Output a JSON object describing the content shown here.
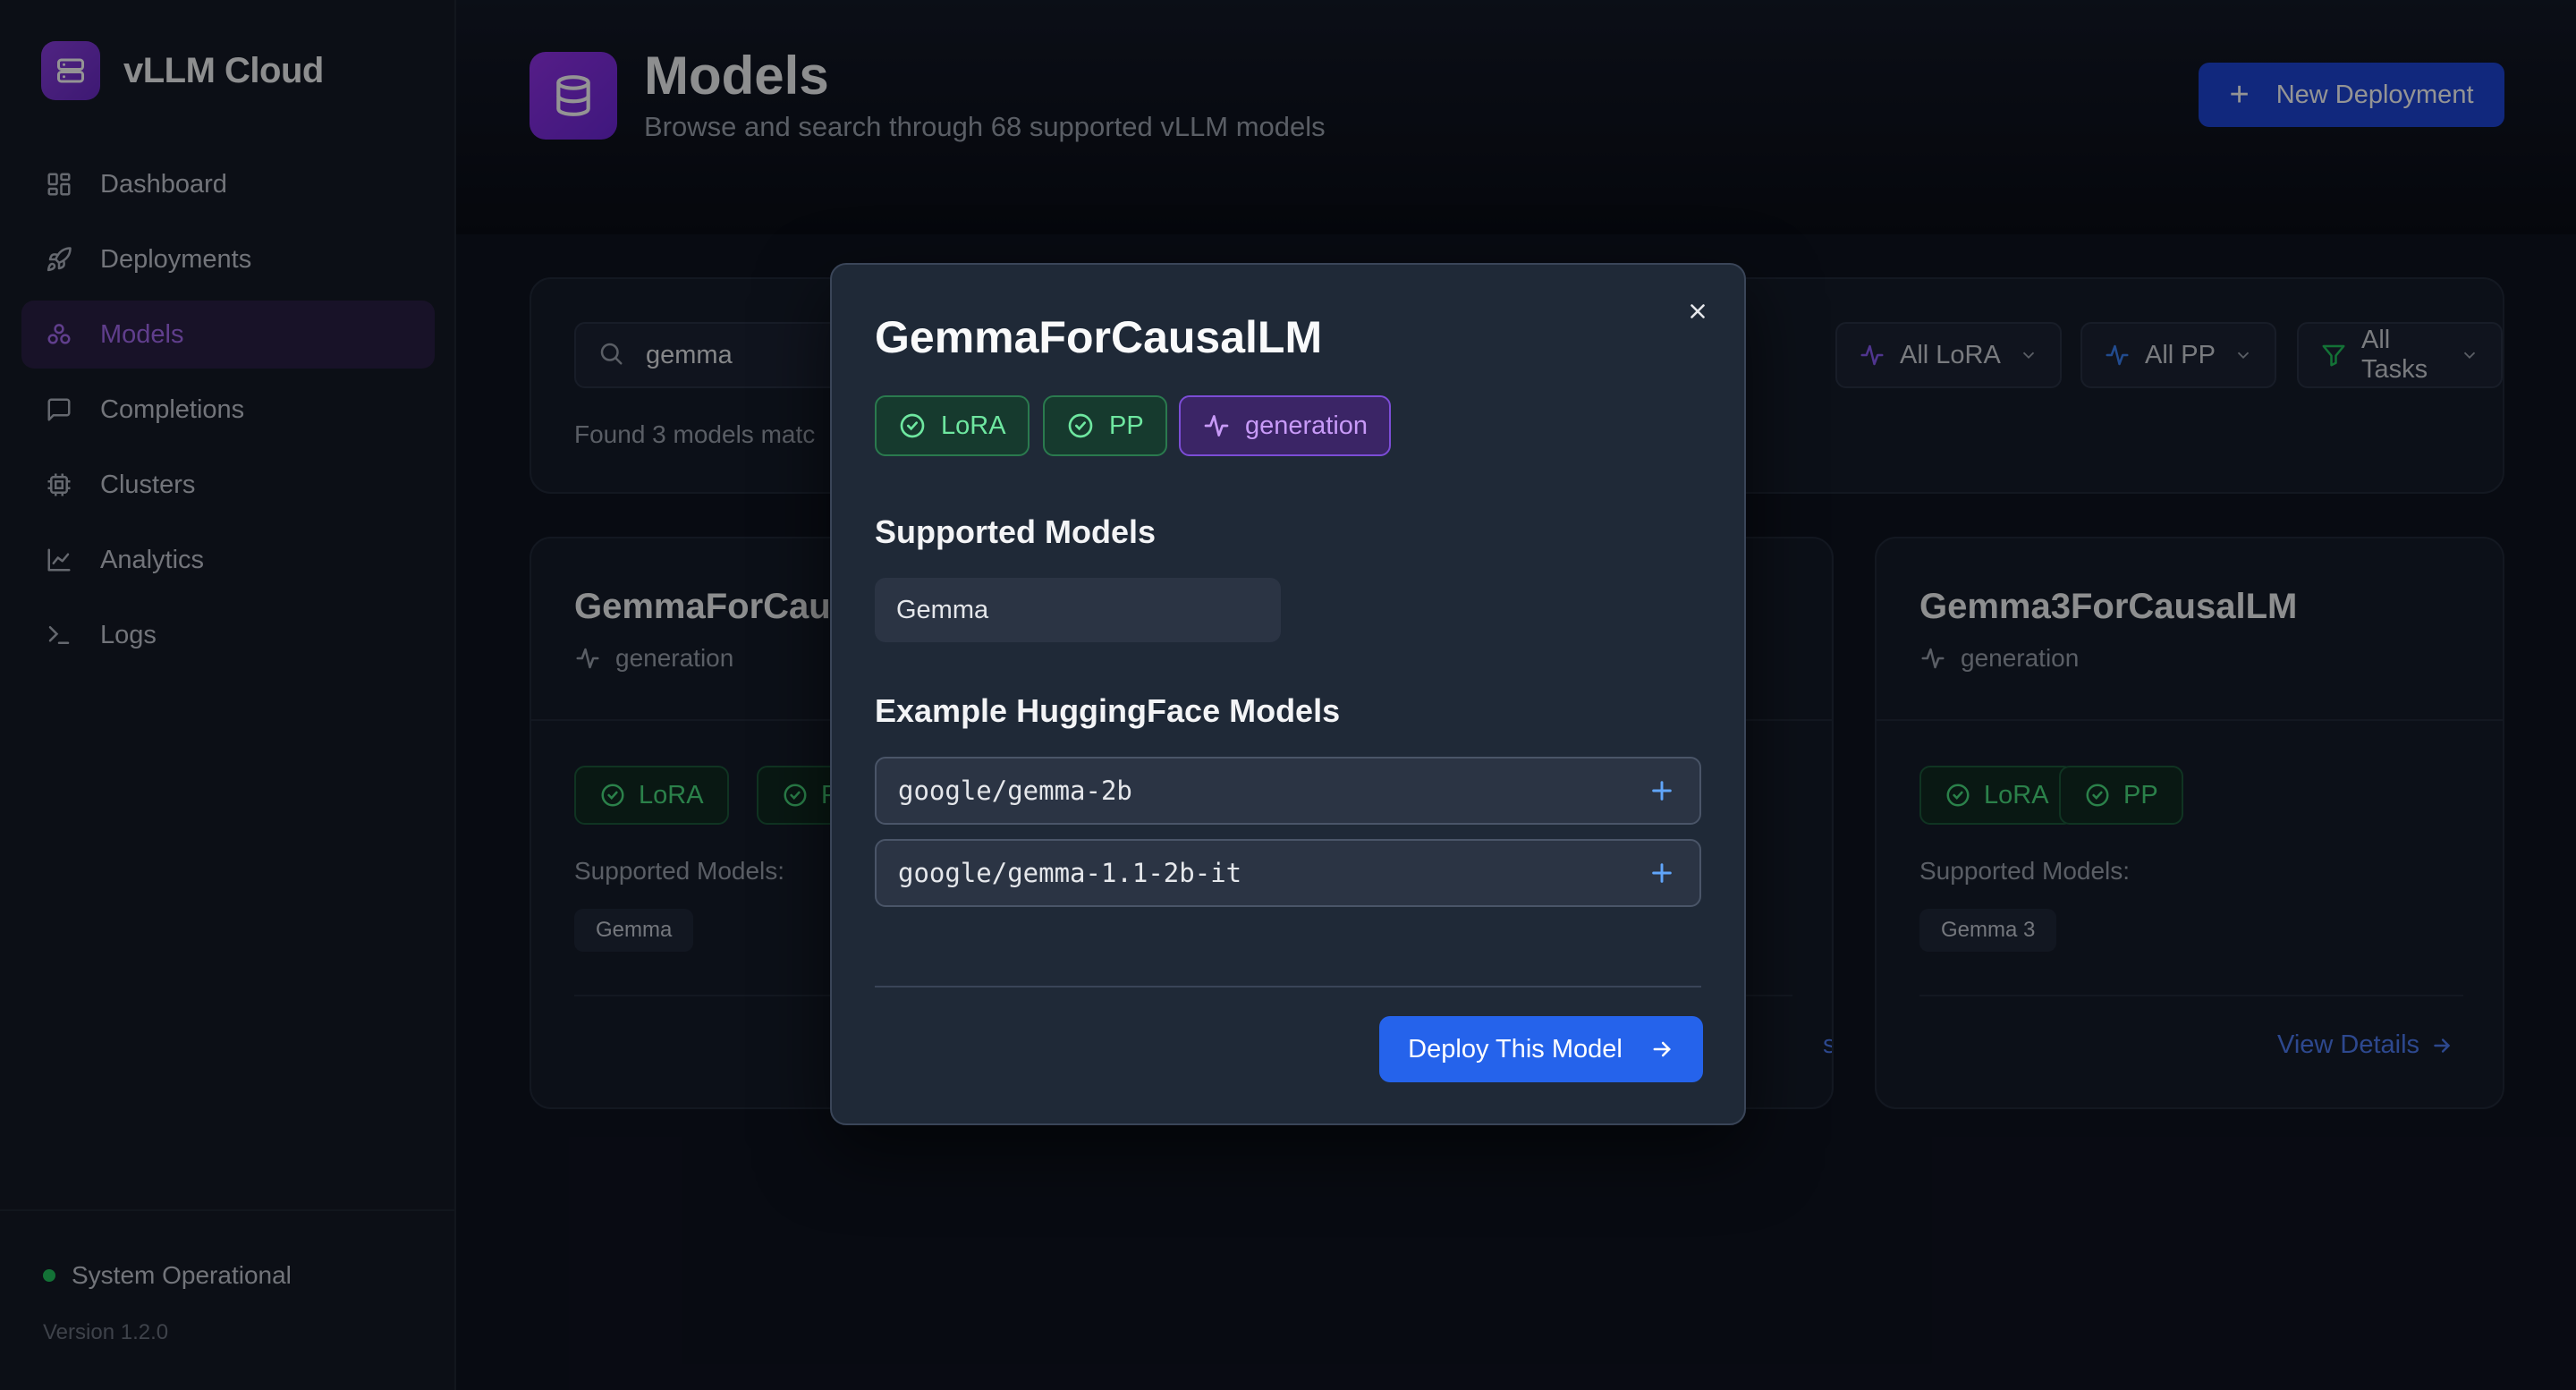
{
  "app": {
    "name": "vLLM Cloud"
  },
  "sidebar": {
    "items": [
      {
        "label": "Dashboard",
        "icon": "dashboard-icon"
      },
      {
        "label": "Deployments",
        "icon": "rocket-icon"
      },
      {
        "label": "Models",
        "icon": "models-icon",
        "active": true
      },
      {
        "label": "Completions",
        "icon": "message-square-icon"
      },
      {
        "label": "Clusters",
        "icon": "cpu-icon"
      },
      {
        "label": "Analytics",
        "icon": "chart-line-icon"
      },
      {
        "label": "Logs",
        "icon": "terminal-icon"
      }
    ],
    "status": "System Operational",
    "version": "Version 1.2.0"
  },
  "header": {
    "title": "Models",
    "subtitle": "Browse and search through 68 supported vLLM models",
    "new_button": "New Deployment"
  },
  "filters": {
    "search_value": "gemma",
    "found_text": "Found 3 models matc",
    "lora": "All LoRA",
    "pp": "All PP",
    "tasks": "All Tasks"
  },
  "cards": [
    {
      "title": "GemmaForCau",
      "task": "generation",
      "badges": [
        "LoRA",
        "P"
      ],
      "supported_label": "Supported Models:",
      "chip": "Gemma",
      "link": "s"
    },
    {
      "title": "Gemma3ForCausalLM",
      "task": "generation",
      "badges": [
        "LoRA",
        "PP"
      ],
      "supported_label": "Supported Models:",
      "chip": "Gemma 3",
      "link": "View Details"
    }
  ],
  "modal": {
    "title": "GemmaForCausalLM",
    "badges": {
      "lora": "LoRA",
      "pp": "PP",
      "task": "generation"
    },
    "supported_title": "Supported Models",
    "supported_chip": "Gemma",
    "examples_title": "Example HuggingFace Models",
    "examples": [
      "google/gemma-2b",
      "google/gemma-1.1-2b-it"
    ],
    "deploy_button": "Deploy This Model"
  },
  "colors": {
    "accent_purple": "#9333ea",
    "primary_blue": "#2563eb",
    "success_green": "#22c55e"
  }
}
